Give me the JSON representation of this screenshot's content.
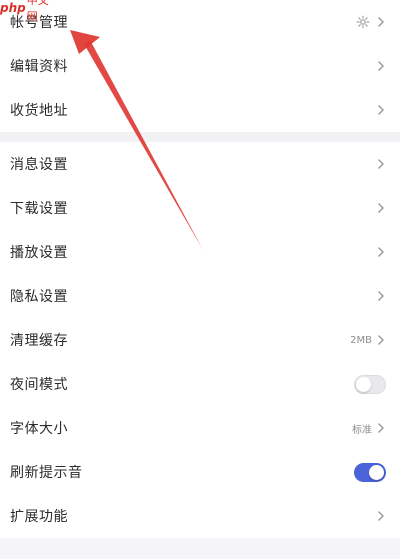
{
  "watermark": {
    "brand": "php",
    "site": "中文网"
  },
  "settings": {
    "group1": [
      {
        "label": "帐号管理",
        "has_gear": true
      },
      {
        "label": "编辑资料"
      },
      {
        "label": "收货地址"
      }
    ],
    "group2": [
      {
        "label": "消息设置"
      },
      {
        "label": "下载设置"
      },
      {
        "label": "播放设置"
      },
      {
        "label": "隐私设置"
      },
      {
        "label": "清理缓存",
        "value": "2MB"
      },
      {
        "label": "夜间模式",
        "toggle": false
      },
      {
        "label": "字体大小",
        "value": "标准"
      },
      {
        "label": "刷新提示音",
        "toggle": true
      },
      {
        "label": "扩展功能"
      }
    ]
  },
  "colors": {
    "accent": "#4a63d9",
    "annotation_arrow": "#e03a35"
  },
  "icons": {
    "gear": "gear-icon",
    "chevron": "chevron-right-icon"
  }
}
